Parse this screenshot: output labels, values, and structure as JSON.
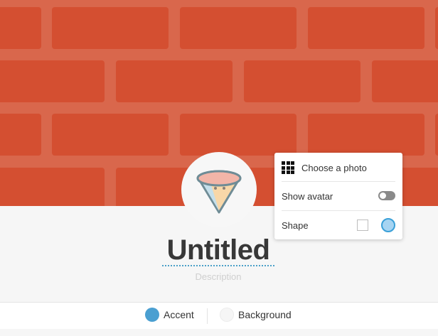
{
  "header": {
    "background_color": "#d65034",
    "brick_color": "#d44f31"
  },
  "profile": {
    "avatar_icon": "ice-cream-cone-icon",
    "title": "Untitled",
    "description_placeholder": "Description"
  },
  "popup_menu": {
    "choose_photo": {
      "label": "Choose a photo",
      "icon": "grid-icon"
    },
    "show_avatar": {
      "label": "Show avatar",
      "enabled": false
    },
    "shape": {
      "label": "Shape",
      "options": [
        "square",
        "circle"
      ],
      "selected": "circle"
    }
  },
  "footer": {
    "accent": {
      "label": "Accent",
      "color": "#4a9fd1"
    },
    "background": {
      "label": "Background",
      "color": "#f6f6f6"
    }
  }
}
